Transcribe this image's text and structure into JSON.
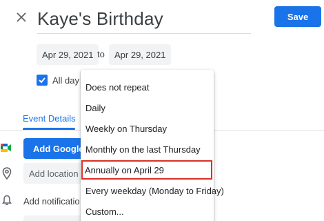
{
  "header": {
    "title": "Kaye's Birthday",
    "save_label": "Save"
  },
  "dates": {
    "start": "Apr 29, 2021",
    "to_label": "to",
    "end": "Apr 29, 2021"
  },
  "all_day": {
    "label": "All day",
    "checked": true
  },
  "tabs": [
    {
      "label": "Event Details",
      "active": true
    }
  ],
  "meet": {
    "button_label": "Add Google"
  },
  "location": {
    "placeholder": "Add location"
  },
  "notification": {
    "label": "Add notificatio"
  },
  "repeat_menu": {
    "items": [
      {
        "label": "Does not repeat"
      },
      {
        "label": "Daily"
      },
      {
        "label": "Weekly on Thursday"
      },
      {
        "label": "Monthly on the last Thursday"
      },
      {
        "label": "Annually on April 29",
        "highlighted": true
      },
      {
        "label": "Every weekday (Monday to Friday)"
      },
      {
        "label": "Custom..."
      }
    ]
  },
  "colors": {
    "accent": "#1a73e8",
    "highlight_box": "#d93025",
    "field_bg": "#f1f3f4"
  },
  "icons": [
    "close-icon",
    "checkbox-check-icon",
    "google-meet-icon",
    "location-pin-icon",
    "bell-icon"
  ]
}
